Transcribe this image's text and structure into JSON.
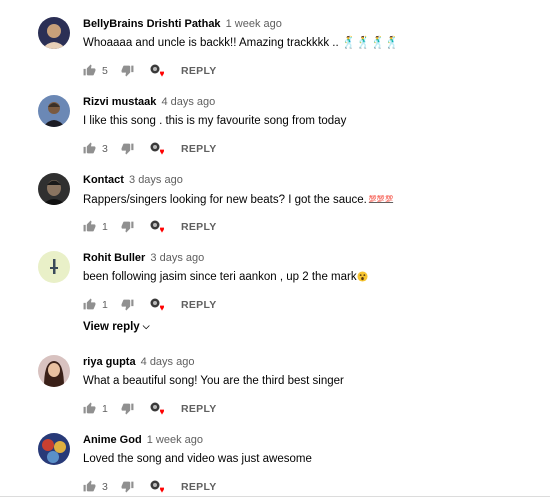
{
  "comments": [
    {
      "author": "BellyBrains Drishti Pathak",
      "time": "1 week ago",
      "text": "Whoaaaa and uncle is backk!! Amazing trackkkk .. 🕺🕺🕺🕺",
      "likes": "5",
      "reply_label": "REPLY",
      "avatar_colors": [
        "#2b2f55",
        "#c8a07a"
      ]
    },
    {
      "author": "Rizvi mustaak",
      "time": "4 days ago",
      "text": "I like this song . this is my favourite song from today",
      "likes": "3",
      "reply_label": "REPLY",
      "avatar_colors": [
        "#6b88b5",
        "#3a3028"
      ]
    },
    {
      "author": "Kontact",
      "time": "3 days ago",
      "text": "Rappers/singers looking for new beats? I got the sauce.",
      "text_suffix": "💯💯💯",
      "likes": "1",
      "reply_label": "REPLY",
      "avatar_colors": [
        "#303030",
        "#8a7460"
      ]
    },
    {
      "author": "Rohit Buller",
      "time": "3 days ago",
      "text": "been following jasim since teri aankon , up 2 the mark",
      "likes": "1",
      "reply_label": "REPLY",
      "view_replies_label": "View reply",
      "avatar_colors": [
        "#e9f0c8",
        "#3a4a5a"
      ]
    },
    {
      "author": "riya gupta",
      "time": "4 days ago",
      "text": "What a beautiful song! You are the third best singer",
      "likes": "1",
      "reply_label": "REPLY",
      "avatar_colors": [
        "#d8c2c0",
        "#3a2018"
      ]
    },
    {
      "author": "Anime God",
      "time": "1 week ago",
      "text": "Loved the song and video was just awesome",
      "likes": "3",
      "reply_label": "REPLY",
      "avatar_colors": [
        "#283a78",
        "#e0b040"
      ]
    }
  ],
  "colors": {
    "text": "#030303",
    "secondary": "#606060",
    "icon": "#909090",
    "heart": "#ff0000"
  },
  "icons": [
    "thumb-up-icon",
    "thumb-down-icon",
    "creator-heart-icon",
    "chevron-down-icon"
  ]
}
